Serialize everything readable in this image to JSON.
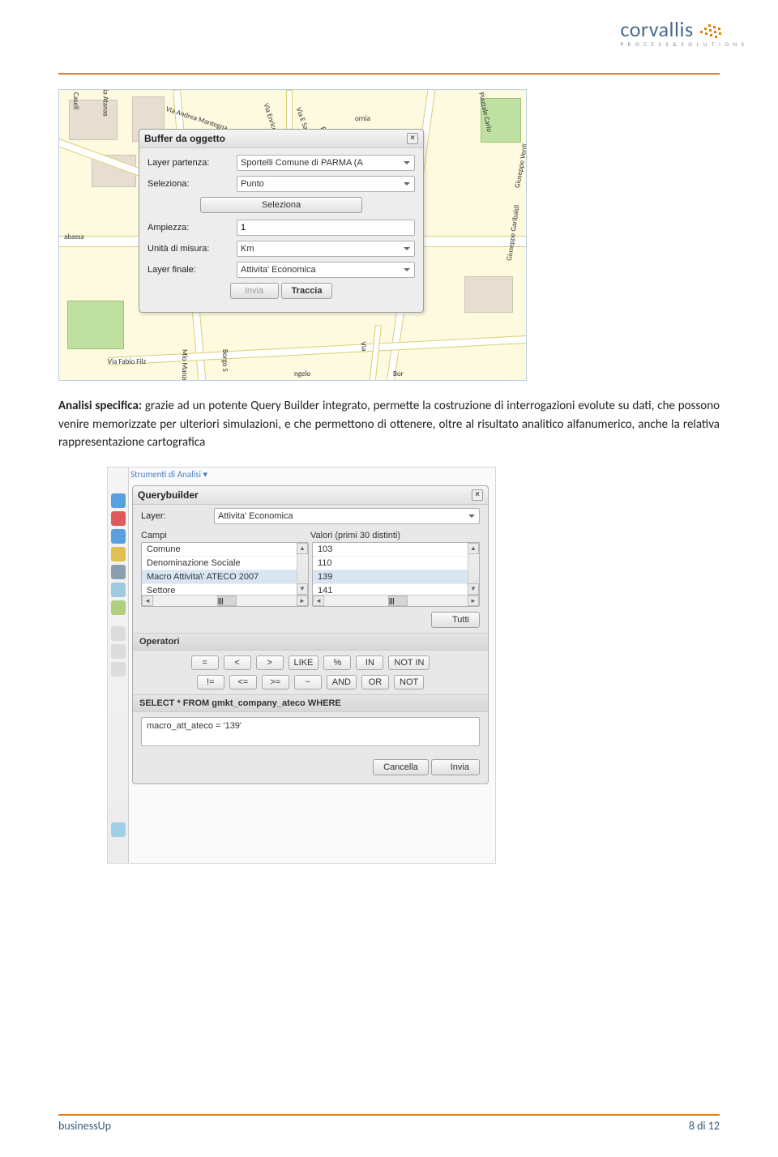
{
  "header": {
    "logo_text": "corvallis",
    "logo_sub": "P R O C E S S   &   S O L U T I O N S"
  },
  "map": {
    "streets": [
      "Via Atanas",
      "Casell",
      "Via Andrea Mantegna",
      "Via Enrico Sartori",
      "Via E Sartori",
      "E Sartori",
      "Piazzale Carlo",
      "Giuseppe Garibaldi",
      "Giuseppe Verdi",
      "Via Fabio Filz",
      "Mlo Manzoni",
      "Borgo S",
      "ngelo",
      "abassa",
      "Bor",
      "Via",
      "ornia"
    ]
  },
  "dlg1": {
    "title": "Buffer da oggetto",
    "labels": {
      "layer_partenza": "Layer partenza:",
      "seleziona": "Seleziona:",
      "ampiezza": "Ampiezza:",
      "unita": "Unità di misura:",
      "layer_finale": "Layer finale:"
    },
    "values": {
      "layer_partenza": "Sportelli Comune di PARMA (A",
      "seleziona": "Punto",
      "ampiezza": "1",
      "unita": "Km",
      "layer_finale": "Attivita' Economica"
    },
    "btn_seleziona": "Seleziona",
    "btn_invia": "Invia",
    "btn_traccia": "Traccia"
  },
  "para": {
    "lead": "Analisi specifica:",
    "text": " grazie ad un potente Query Builder integrato, permette la costruzione di interrogazioni evolute su dati, che possono venire memorizzate per ulteriori simulazioni, e che permettono di ottenere, oltre al risultato analitico alfanumerico, anche la relativa rappresentazione cartografica"
  },
  "qb": {
    "strumenti": "Strumenti di Analisi",
    "title": "Querybuilder",
    "layer_label": "Layer:",
    "layer_value": "Attivita' Economica",
    "campi_label": "Campi",
    "valori_label": "Valori (primi 30 distinti)",
    "campi": [
      "Comune",
      "Denominazione Sociale",
      "Macro Attivita\\' ATECO 2007",
      "Settore"
    ],
    "valori": [
      "103",
      "110",
      "139",
      "141"
    ],
    "btn_tutti": "Tutti",
    "operatori_label": "Operatori",
    "ops_row1": [
      "=",
      "<",
      ">",
      "LIKE",
      "%",
      "IN",
      "NOT IN"
    ],
    "ops_row2": [
      "!=",
      "<=",
      ">=",
      "~",
      "AND",
      "OR",
      "NOT"
    ],
    "select_label": "SELECT * FROM gmkt_company_ateco WHERE",
    "query_text": "macro_att_ateco  =  '139'",
    "btn_cancella": "Cancella",
    "btn_invia": "Invia"
  },
  "footer": {
    "left": "businessUp",
    "right": "8 di 12"
  }
}
